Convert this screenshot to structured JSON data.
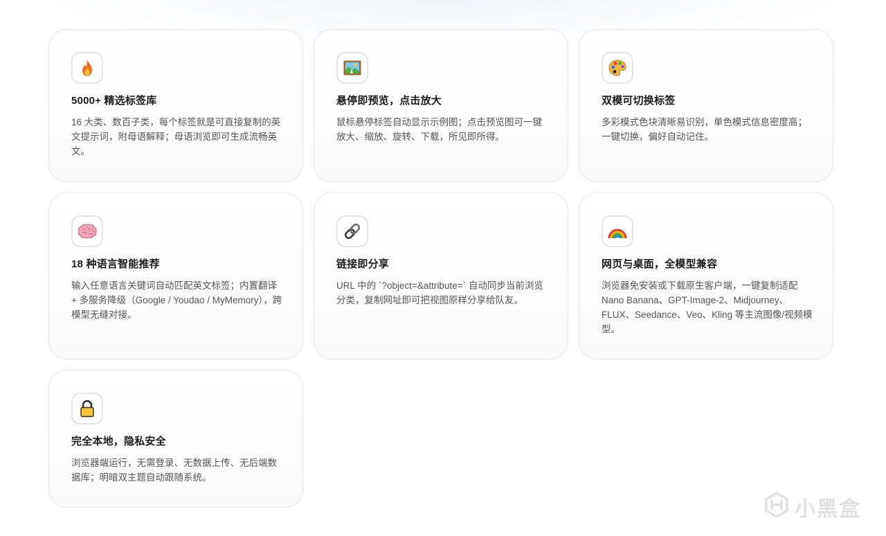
{
  "features": [
    {
      "icon": "fire-icon",
      "title": "5000+ 精选标签库",
      "description": "16 大类、数百子类，每个标签就是可直接复制的英文提示词，附母语解释；母语浏览即可生成流畅英文。"
    },
    {
      "icon": "framed-picture-icon",
      "title": "悬停即预览，点击放大",
      "description": "鼠标悬停标签自动显示示例图；点击预览图可一键放大、缩放、旋转、下载，所见即所得。"
    },
    {
      "icon": "palette-icon",
      "title": "双模可切换标签",
      "description": "多彩模式色块清晰易识别，单色模式信息密度高；一键切换，偏好自动记住。"
    },
    {
      "icon": "brain-icon",
      "title": "18 种语言智能推荐",
      "description": "输入任意语言关键词自动匹配英文标签；内置翻译 + 多服务降级（Google / Youdao / MyMemory），跨模型无缝对接。"
    },
    {
      "icon": "link-icon",
      "title": "链接即分享",
      "description": "URL 中的 `?object=&attribute=` 自动同步当前浏览分类，复制网址即可把视图原样分享给队友。"
    },
    {
      "icon": "rainbow-icon",
      "title": "网页与桌面，全模型兼容",
      "description": "浏览器免安装或下载原生客户端，一键复制适配 Nano Banana、GPT-Image-2、Midjourney、FLUX、Seedance、Veo、Kling 等主流图像/视频模型。"
    },
    {
      "icon": "lock-icon",
      "title": "完全本地，隐私安全",
      "description": "浏览器端运行，无需登录、无数据上传、无后端数据库；明暗双主题自动跟随系统。"
    }
  ],
  "watermark": {
    "text": "小黑盒",
    "icon": "xiaoheihe-logo-icon"
  }
}
